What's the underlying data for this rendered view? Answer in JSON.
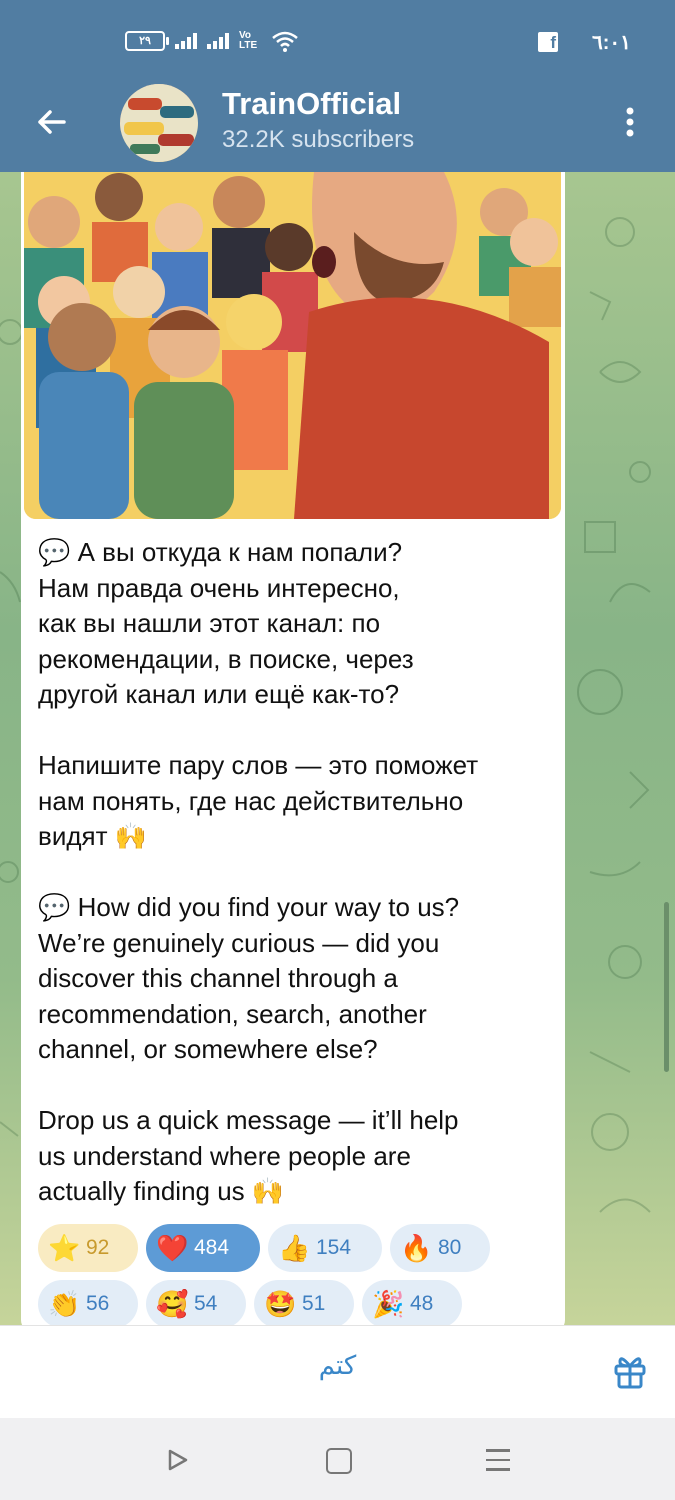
{
  "status_bar": {
    "battery": "٢٩",
    "network_label": "Vo LTE",
    "time": "٦:٠١",
    "facebook": "f"
  },
  "header": {
    "title": "TrainOfficial",
    "subscribers": "32.2K subscribers"
  },
  "message": {
    "paragraphs": [
      "💬 А вы откуда к нам попали?\nНам правда очень интересно,\nкак вы нашли этот канал: по\nрекомендации, в поиске, через\nдругой канал или ещё как-то?",
      "Напишите пару слов — это поможет\nнам понять, где нас действительно\nвидят 🙌",
      "💬 How did you find your way to us?\nWe’re genuinely curious — did you\ndiscover this channel through a\nrecommendation, search, another\nchannel, or somewhere else?",
      "Drop us a quick message — it’ll help\nus understand where people are\nactually finding us 🙌"
    ]
  },
  "reactions": [
    {
      "icon": "⭐",
      "name": "star-reaction",
      "count": "92"
    },
    {
      "icon": "❤️",
      "name": "heart-reaction",
      "count": "484"
    },
    {
      "icon": "👍",
      "name": "thumbs-up-reaction",
      "count": "154"
    },
    {
      "icon": "🔥",
      "name": "fire-reaction",
      "count": "80"
    },
    {
      "icon": "👏",
      "name": "clap-reaction",
      "count": "56"
    },
    {
      "icon": "🥰",
      "name": "smiling-hearts-reaction",
      "count": "54"
    },
    {
      "icon": "🤩",
      "name": "star-struck-reaction",
      "count": "51"
    },
    {
      "icon": "🎉",
      "name": "party-popper-reaction",
      "count": "48"
    }
  ],
  "bottom_bar": {
    "mute_label": "كتم"
  },
  "colors": {
    "header": "#517da2",
    "accent": "#3a87c8",
    "active_reaction": "#5d9bd6"
  }
}
